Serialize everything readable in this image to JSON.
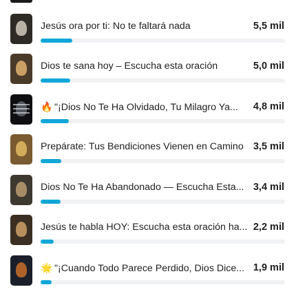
{
  "rows": [
    {
      "title": "Jesús ora por ti: No te faltará nada",
      "emoji": "",
      "count": "5,5 mil",
      "progress": 0.13,
      "thumb": "#2e2a26",
      "glow": "#e8dfd0"
    },
    {
      "title": "Dios te sana hoy – Escucha esta oración",
      "emoji": "",
      "count": "5,0 mil",
      "progress": 0.12,
      "thumb": "#4a3a2a",
      "glow": "#f4c27a"
    },
    {
      "title": "\"¡Dios No Te Ha Olvidado, Tu Milagro Ya...",
      "emoji": "🔥",
      "count": "4,8 mil",
      "progress": 0.115,
      "thumb": "#0f0f12",
      "glow": "#6a6f78"
    },
    {
      "title": "Prepárate: Tus Bendiciones Vienen en Camino",
      "emoji": "",
      "count": "3,5 mil",
      "progress": 0.085,
      "thumb": "#7a5a30",
      "glow": "#f0c86a"
    },
    {
      "title": "Dios No Te Ha Abandonado — Escucha Esta...",
      "emoji": "",
      "count": "3,4 mil",
      "progress": 0.082,
      "thumb": "#3d3830",
      "glow": "#c9a97a"
    },
    {
      "title": "Jesús te habla HOY: Escucha esta oración ha...",
      "emoji": "",
      "count": "2,2 mil",
      "progress": 0.053,
      "thumb": "#3a2f22",
      "glow": "#e0b070"
    },
    {
      "title": "\"¡Cuando Todo Parece Perdido, Dios Dice...",
      "emoji": "🌟",
      "count": "1,9 mil",
      "progress": 0.046,
      "thumb": "#1a1f2a",
      "glow": "#e07a2a"
    }
  ]
}
